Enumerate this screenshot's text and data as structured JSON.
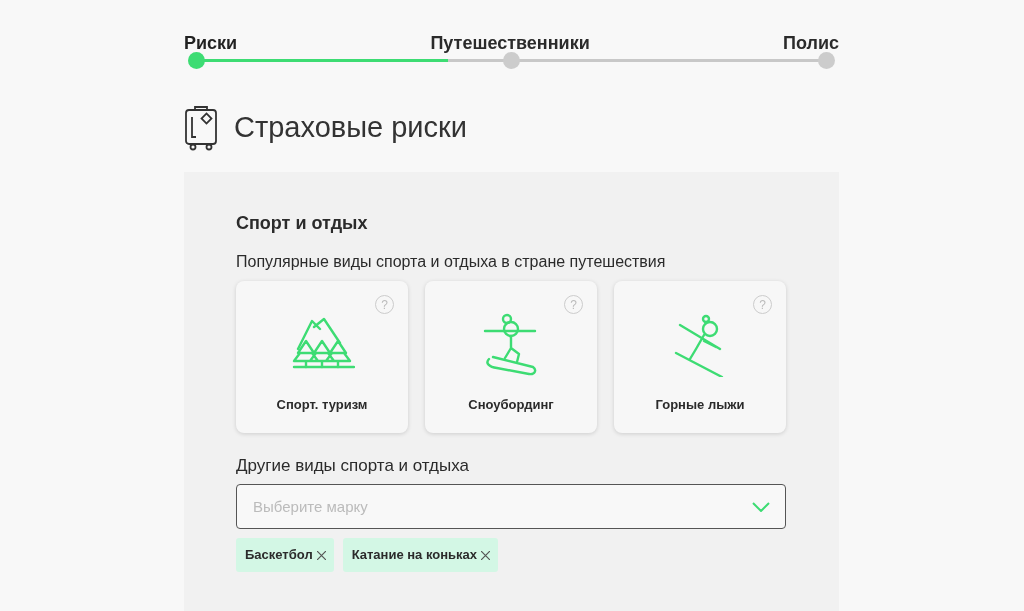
{
  "stepper": {
    "steps": [
      {
        "label": "Риски",
        "selected": true
      },
      {
        "label": "Путешественники",
        "selected": false
      },
      {
        "label": "Полис",
        "selected": false
      }
    ],
    "level": 0.4
  },
  "heading": "Страховые риски",
  "section": {
    "title": "Спорт и отдых",
    "subtitle": "Популярные виды спорта и отдыха в стране путешествия",
    "cards": [
      {
        "kind": "tourism",
        "label": "Спорт. туризм",
        "help": "?"
      },
      {
        "kind": "snowboard",
        "label": "Сноубординг",
        "help": "?"
      },
      {
        "kind": "ski",
        "label": "Горные лыжи",
        "help": "?"
      }
    ],
    "other_label": "Другие виды спорта и отдыха",
    "dropdown": {
      "placeholder": "Выберите марку"
    },
    "chips": [
      {
        "label": "Баскетбол"
      },
      {
        "label": "Катание на коньках"
      }
    ]
  }
}
